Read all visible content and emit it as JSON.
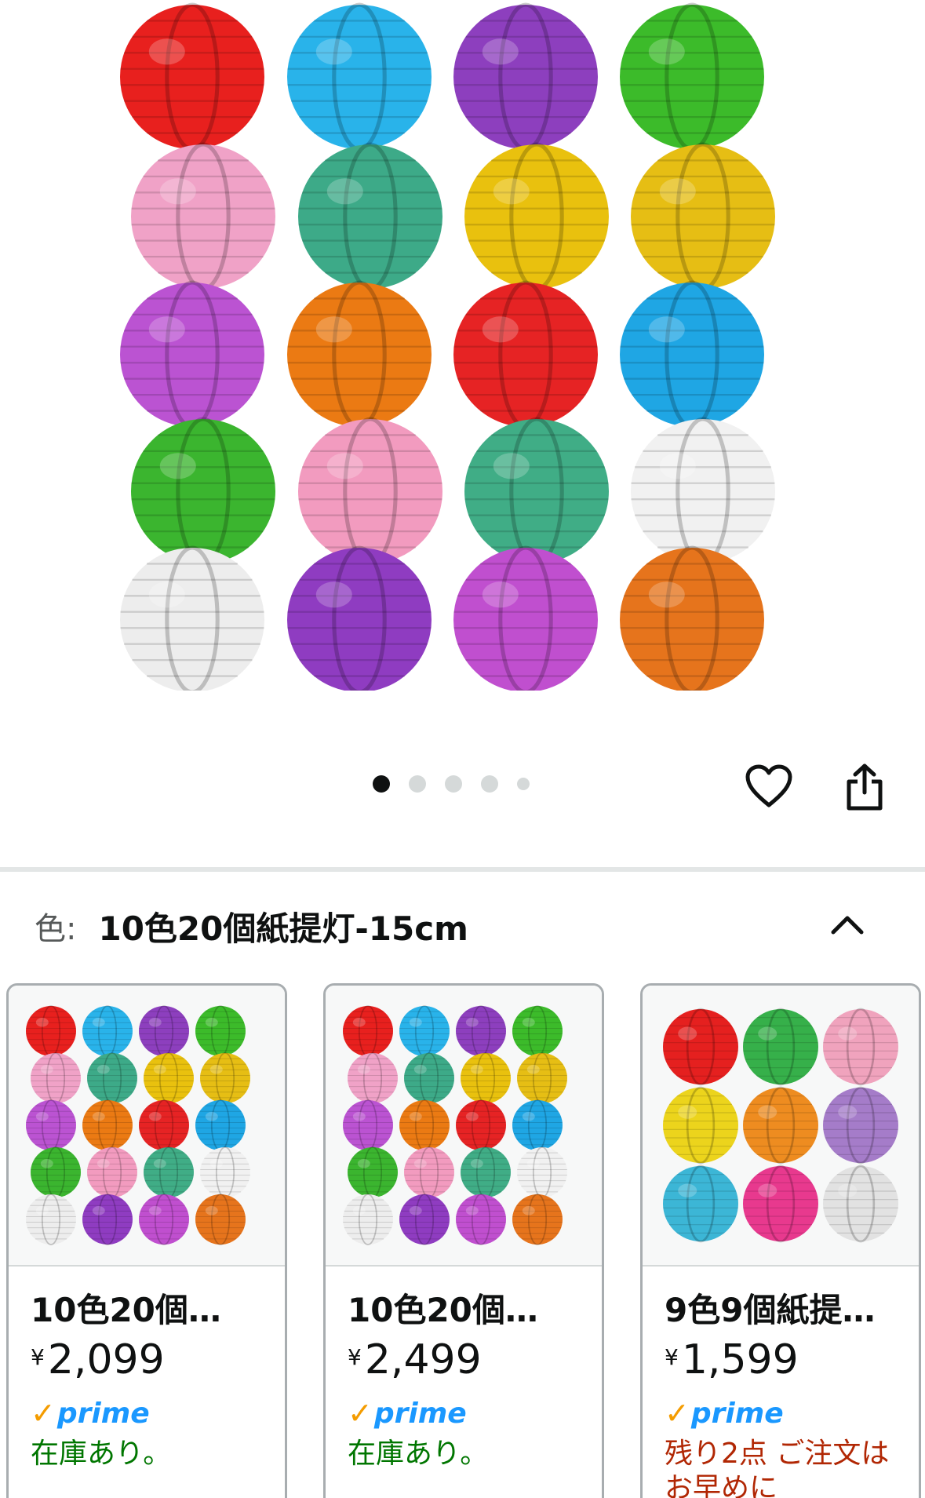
{
  "product": {
    "image_name": "paper-lantern-set-photo",
    "lantern_colors": [
      "#e8201e",
      "#29b3ea",
      "#8d3fbe",
      "#3cbb2a",
      "#f0a2c7",
      "#3daa88",
      "#e9c10e",
      "#e6be14",
      "#bb53d2",
      "#eb7a13",
      "#e62324",
      "#1fa6e4",
      "#3bb52f",
      "#f29bbf",
      "#40ad86",
      "#f1f1f1",
      "#ededed",
      "#8f3cc1",
      "#c04fcf",
      "#e6741c"
    ]
  },
  "carousel": {
    "count": 5,
    "active_index": 0
  },
  "actions": {
    "wishlist_icon": "heart-outline-icon",
    "share_icon": "share-icon"
  },
  "variation": {
    "label": "色:",
    "value": "10色20個紙提灯-15cm",
    "toggle_icon": "chevron-up-icon"
  },
  "options": [
    {
      "title": "10色20個…",
      "currency": "¥",
      "price": "2,099",
      "prime_check": "✓",
      "prime_label": "prime",
      "stock": "在庫あり。",
      "stock_color": "#007600",
      "swatches": [
        "#e8201e",
        "#29b3ea",
        "#8d3fbe",
        "#3cbb2a",
        "#f0a2c7",
        "#3daa88",
        "#e9c10e",
        "#e6be14",
        "#bb53d2",
        "#eb7a13",
        "#e62324",
        "#1fa6e4",
        "#3bb52f",
        "#f29bbf",
        "#40ad86",
        "#f1f1f1",
        "#ededed",
        "#8f3cc1",
        "#c04fcf",
        "#e6741c"
      ]
    },
    {
      "title": "10色20個…",
      "currency": "¥",
      "price": "2,499",
      "prime_check": "✓",
      "prime_label": "prime",
      "stock": "在庫あり。",
      "stock_color": "#007600",
      "swatches": [
        "#e8201e",
        "#29b3ea",
        "#8d3fbe",
        "#3cbb2a",
        "#f0a2c7",
        "#3daa88",
        "#e9c10e",
        "#e6be14",
        "#bb53d2",
        "#eb7a13",
        "#e62324",
        "#1fa6e4",
        "#3bb52f",
        "#f29bbf",
        "#40ad86",
        "#f1f1f1",
        "#ededed",
        "#8f3cc1",
        "#c04fcf",
        "#e6741c"
      ]
    },
    {
      "title": "9色9個紙提…",
      "currency": "¥",
      "price": "1,599",
      "prime_check": "✓",
      "prime_label": "prime",
      "stock": "残り2点 ご注文はお早めに",
      "stock_color": "#b12704",
      "swatches": [
        "#e5201f",
        "#36b04a",
        "#f0a3bd",
        "#ecd41c",
        "#ee8c20",
        "#a57cc9",
        "#3cb6d6",
        "#e8398e",
        "#e2e2e2"
      ]
    }
  ]
}
